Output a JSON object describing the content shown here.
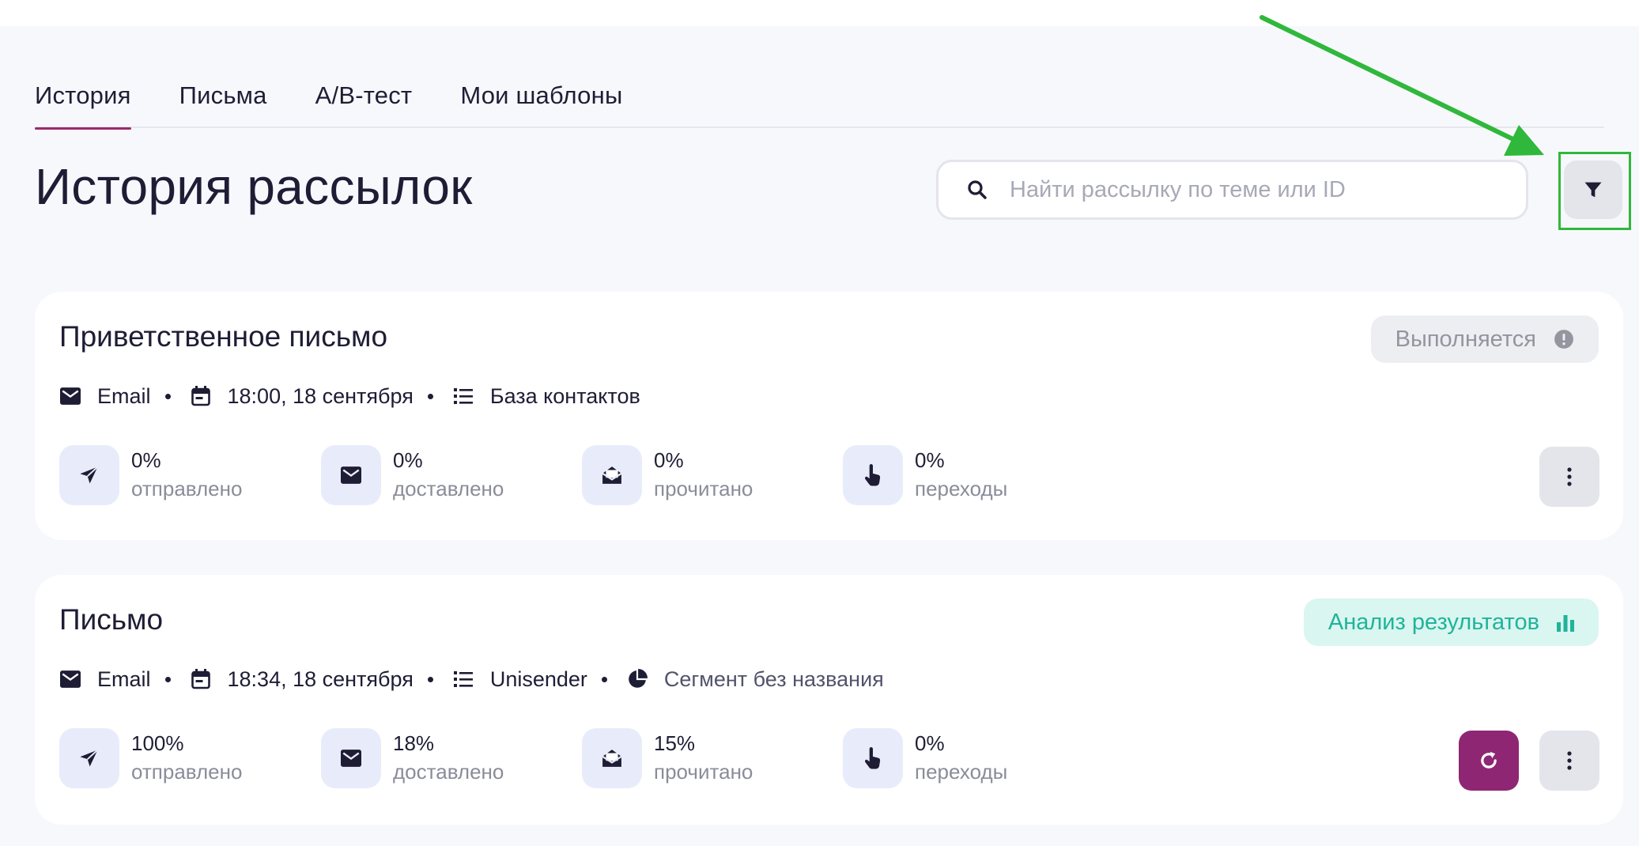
{
  "tabs": [
    {
      "label": "История",
      "active": true
    },
    {
      "label": "Письма"
    },
    {
      "label": "A/B-тест"
    },
    {
      "label": "Мои шаблоны"
    }
  ],
  "page_title": "История рассылок",
  "search": {
    "placeholder": "Найти рассылку по теме или ID",
    "icon": "search-icon"
  },
  "filter_button": {
    "icon": "filter-icon",
    "highlight_color": "#2fb83b"
  },
  "colors": {
    "accent": "#9c2b6c",
    "refresh_button": "#8f2674",
    "analysis_text": "#21b39a",
    "analysis_bg": "#d9f6f0"
  },
  "campaigns": [
    {
      "title": "Приветственное письмо",
      "channel": "Email",
      "datetime": "18:00, 18 сентября",
      "list": "База контактов",
      "status": "Выполняется",
      "stats": [
        {
          "value": "0%",
          "label": "отправлено",
          "icon": "send-icon"
        },
        {
          "value": "0%",
          "label": "доставлено",
          "icon": "envelope-icon"
        },
        {
          "value": "0%",
          "label": "прочитано",
          "icon": "open-envelope-icon"
        },
        {
          "value": "0%",
          "label": "переходы",
          "icon": "pointer-hand-icon"
        }
      ]
    },
    {
      "title": "Письмо",
      "channel": "Email",
      "datetime": "18:34, 18 сентября",
      "list": "Unisender",
      "segment": "Сегмент без названия",
      "status": "Анализ результатов",
      "stats": [
        {
          "value": "100%",
          "label": "отправлено",
          "icon": "send-icon"
        },
        {
          "value": "18%",
          "label": "доставлено",
          "icon": "envelope-icon"
        },
        {
          "value": "15%",
          "label": "прочитано",
          "icon": "open-envelope-icon"
        },
        {
          "value": "0%",
          "label": "переходы",
          "icon": "pointer-hand-icon"
        }
      ]
    }
  ]
}
